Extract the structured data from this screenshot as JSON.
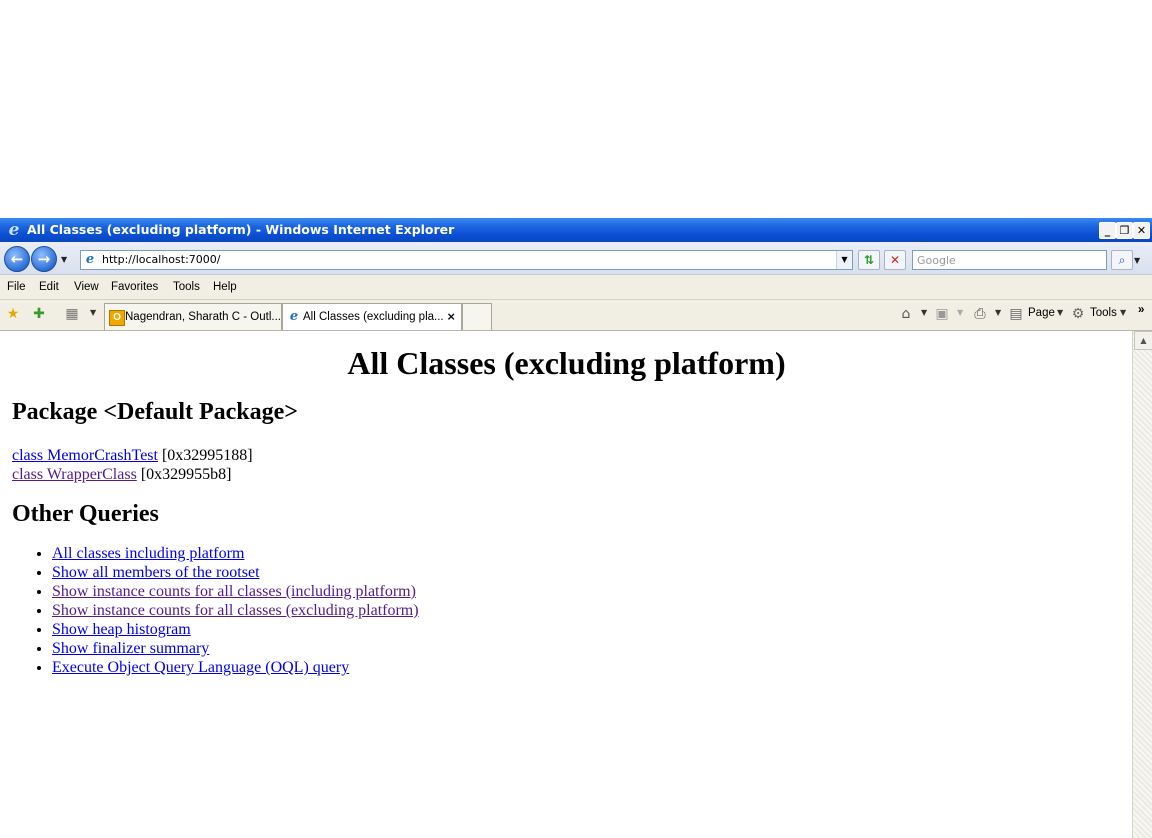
{
  "window": {
    "title": "All Classes (excluding platform) - Windows Internet Explorer",
    "controls": {
      "minimize": "_",
      "restore": "❐",
      "close": "✕"
    }
  },
  "address_bar": {
    "url": "http://localhost:7000/",
    "search_placeholder": "Google"
  },
  "menu": {
    "items": [
      "File",
      "Edit",
      "View",
      "Favorites",
      "Tools",
      "Help"
    ]
  },
  "tabs": [
    {
      "label": "Nagendran, Sharath C - Outl...",
      "active": false
    },
    {
      "label": "All Classes (excluding pla...",
      "active": true
    }
  ],
  "command_bar": {
    "page_label": "Page",
    "tools_label": "Tools"
  },
  "page": {
    "title": "All Classes (excluding platform)",
    "package_heading": "Package <Default Package>",
    "classes": [
      {
        "link": "class MemorCrashTest",
        "address": " [0x32995188]",
        "visited": false
      },
      {
        "link": "class WrapperClass",
        "address": " [0x329955b8]",
        "visited": true
      }
    ],
    "other_heading": "Other Queries",
    "queries": [
      {
        "label": "All classes including platform",
        "visited": false
      },
      {
        "label": "Show all members of the rootset",
        "visited": false
      },
      {
        "label": "Show instance counts for all classes (including platform)",
        "visited": true
      },
      {
        "label": "Show instance counts for all classes (excluding platform)",
        "visited": true
      },
      {
        "label": "Show heap histogram",
        "visited": false
      },
      {
        "label": "Show finalizer summary",
        "visited": false
      },
      {
        "label": "Execute Object Query Language (OQL) query",
        "visited": false
      }
    ]
  },
  "colors": {
    "link": "#0000ee",
    "visited_link": "#551a8b",
    "titlebar": "#0a4fd4"
  }
}
